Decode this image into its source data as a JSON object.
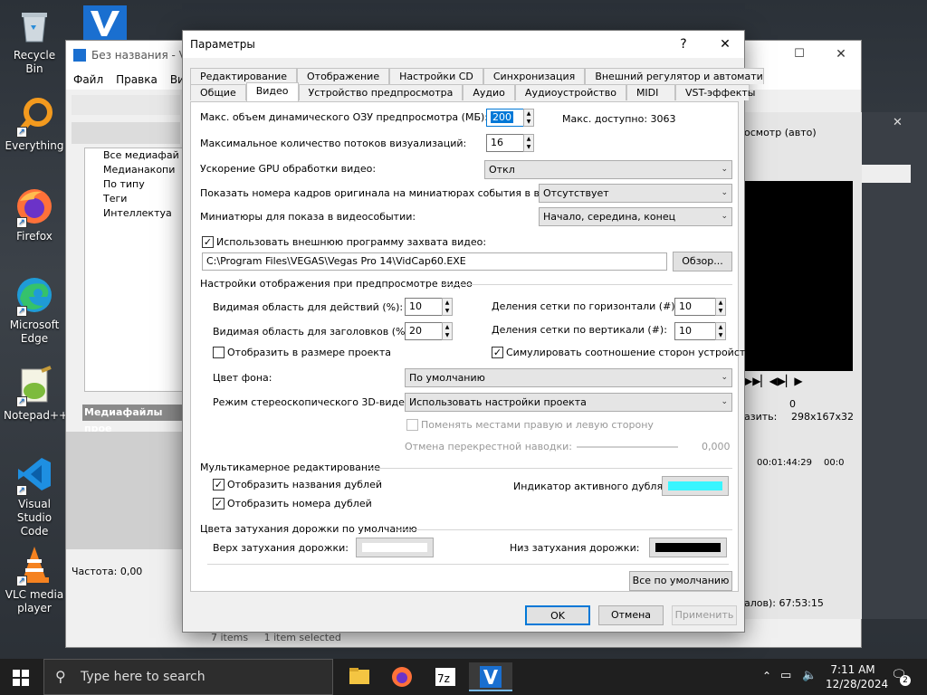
{
  "desktop": {
    "icons": [
      {
        "label": "Recycle Bin"
      },
      {
        "label": "Everything"
      },
      {
        "label": "Firefox"
      },
      {
        "label": "Microsoft Edge"
      },
      {
        "label": "Notepad++"
      },
      {
        "label": "Visual Studio Code"
      },
      {
        "label": "VLC media player"
      }
    ]
  },
  "bgwindow": {
    "title": "Без названия - VEG",
    "menu": [
      "Файл",
      "Правка",
      "Вид"
    ],
    "tree": [
      "Все медиафай",
      "Медианакопи",
      "По типу",
      "Теги",
      "Интеллектуа"
    ],
    "media_label": "Медиафайлы прое",
    "freq": "Частота: 0,00",
    "preview": "осмотр (авто)",
    "size_label": "азить:",
    "size_value": "298x167x32",
    "zero": "0",
    "time1": "00:01:44:29",
    "time2": "00:0",
    "duration": "алов): 67:53:15",
    "status_items": "7 items",
    "status_selected": "1 item selected"
  },
  "dialog": {
    "title": "Параметры",
    "help": "?",
    "close": "✕",
    "tabs_row1": [
      "Редактирование",
      "Отображение",
      "Настройки CD",
      "Синхронизация",
      "Внешний регулятор и автоматизац"
    ],
    "tabs_row2": [
      "Общие",
      "Видео",
      "Устройство предпросмотра",
      "Аудио",
      "Аудиоустройство",
      "MIDI",
      "VST-эффекты"
    ],
    "ram_label": "Макс. объем динамического ОЗУ предпросмотра (МБ):",
    "ram_value": "200",
    "ram_available": "Макс. доступно: 3063",
    "threads_label": "Максимальное количество потоков визуализаций:",
    "threads_value": "16",
    "gpu_label": "Ускорение GPU обработки видео:",
    "gpu_value": "Откл",
    "frames_label": "Показать номера кадров оригинала на миниатюрах события в виде:",
    "frames_value": "Отсутствует",
    "thumbs_label": "Миниатюры для показа в видеособытии:",
    "thumbs_value": "Начало, середина, конец",
    "ext_capture_label": "Использовать внешнюю программу захвата видео:",
    "ext_capture_path": "C:\\Program Files\\VEGAS\\Vegas Pro 14\\VidCap60.EXE",
    "browse": "Обзор...",
    "preview_section": "Настройки отображения при предпросмотре видео",
    "action_safe_label": "Видимая область для действий (%):",
    "action_safe_value": "10",
    "title_safe_label": "Видимая область для заголовков (%):",
    "title_safe_value": "20",
    "grid_h_label": "Деления сетки по горизонтали (#):",
    "grid_h_value": "10",
    "grid_v_label": "Деления сетки по вертикали (#):",
    "grid_v_value": "10",
    "project_size_label": "Отобразить в размере проекта",
    "simulate_aspect_label": "Симулировать соотношение сторон устройства",
    "bg_color_label": "Цвет фона:",
    "bg_color_value": "По умолчанию",
    "stereo_label": "Режим стереоскопического 3D-видео:",
    "stereo_value": "Использовать настройки проекта",
    "swap_label": "Поменять местами правую и левую сторону",
    "crosstalk_label": "Отмена перекрестной наводки:",
    "crosstalk_value": "0,000",
    "multicam_section": "Мультикамерное редактирование",
    "take_names_label": "Отобразить названия дублей",
    "take_numbers_label": "Отобразить номера дублей",
    "active_take_label": "Индикатор активного дубля:",
    "active_take_color": "#39f5ff",
    "fade_section": "Цвета затухания дорожки по умолчанию",
    "fade_top_label": "Верх затухания дорожки:",
    "fade_top_color": "#ffffff",
    "fade_bottom_label": "Низ затухания дорожки:",
    "fade_bottom_color": "#000000",
    "defaults_button": "Все по умолчанию",
    "ok": "OK",
    "cancel": "Отмена",
    "apply": "Применить"
  },
  "taskbar": {
    "search_placeholder": "Type here to search",
    "time": "7:11 AM",
    "date": "12/28/2024",
    "notif_count": "2"
  }
}
